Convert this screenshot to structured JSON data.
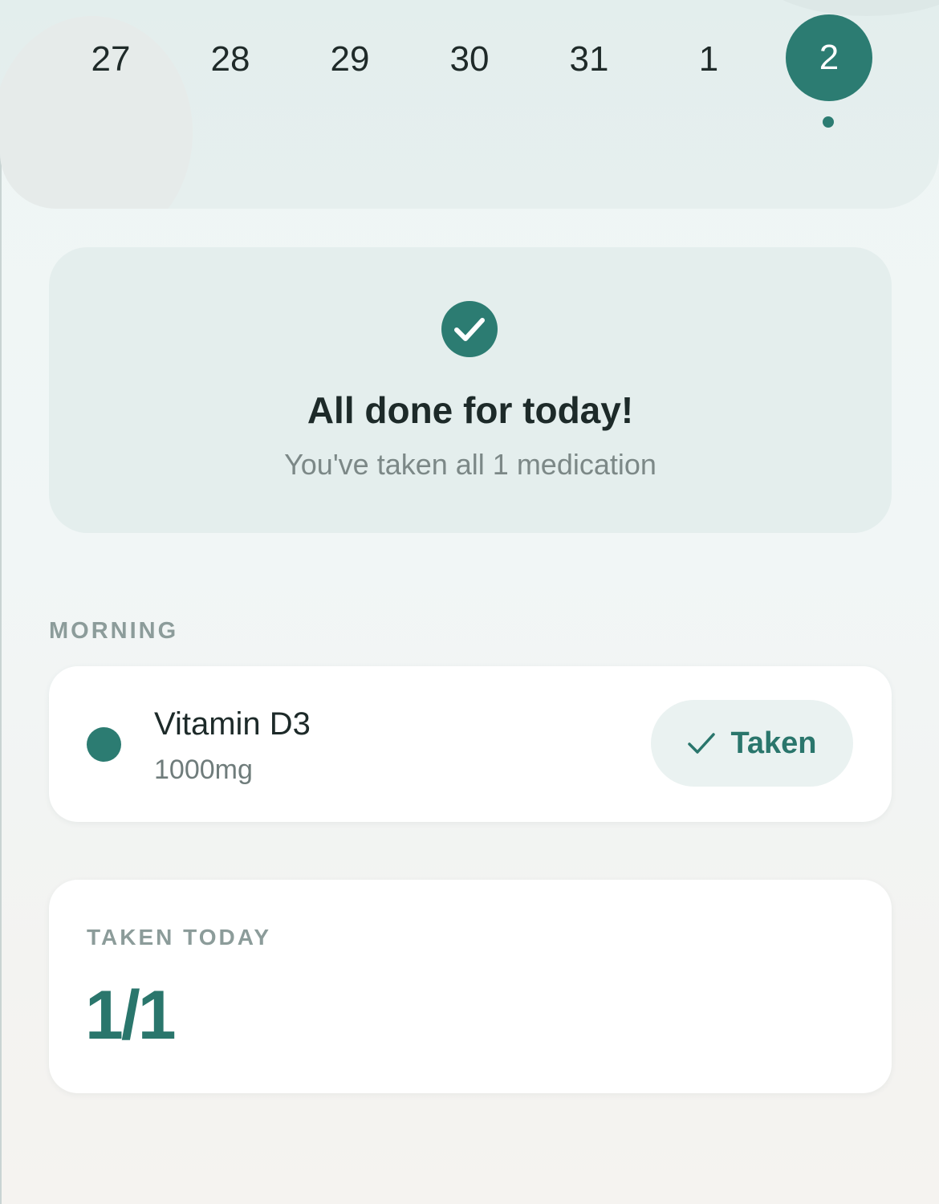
{
  "dates": [
    {
      "day": "27",
      "selected": false
    },
    {
      "day": "28",
      "selected": false
    },
    {
      "day": "29",
      "selected": false
    },
    {
      "day": "30",
      "selected": false
    },
    {
      "day": "31",
      "selected": false
    },
    {
      "day": "1",
      "selected": false
    },
    {
      "day": "2",
      "selected": true
    }
  ],
  "summary": {
    "title": "All done for today!",
    "subtitle": "You've taken all 1 medication"
  },
  "schedule": {
    "section_label": "MORNING",
    "medications": [
      {
        "name": "Vitamin D3",
        "dose": "1000mg",
        "status_label": "Taken"
      }
    ]
  },
  "stats": {
    "label": "TAKEN TODAY",
    "value": "1/1"
  },
  "colors": {
    "accent": "#2c7c72",
    "accent_text": "#2a766c",
    "muted_label": "#8c9c9a",
    "card_tint": "#e4eeed"
  },
  "icons": {
    "done": "check-circle-icon",
    "taken": "checkmark-icon",
    "medication": "color-dot-icon"
  }
}
